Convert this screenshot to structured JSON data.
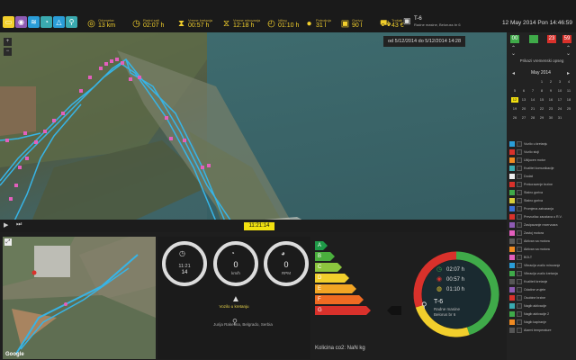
{
  "colors": {
    "accent_yellow": "#f2cf2c",
    "track_blue": "#37b4e6",
    "marker_pink": "#e35fbd",
    "green": "#3faa49",
    "red": "#d9312b",
    "orange": "#ef8a22"
  },
  "toolbar": {
    "buttons": [
      {
        "icon": "chat-icon",
        "color": "#f2cf2c",
        "glyph": "▭"
      },
      {
        "icon": "eye-icon",
        "color": "#8e5bb3",
        "glyph": "◉"
      },
      {
        "icon": "layers-icon",
        "color": "#2a9dd8",
        "glyph": "≋"
      },
      {
        "icon": "gauge-icon",
        "color": "#3aaab0",
        "glyph": "◔"
      },
      {
        "icon": "warning-icon",
        "color": "#2a9dd8",
        "glyph": "△"
      },
      {
        "icon": "pin-icon",
        "color": "#3aaab0",
        "glyph": "⚲"
      }
    ],
    "stats": [
      {
        "icon": "road-icon",
        "glyph": "◎",
        "label": "Odometar",
        "value": "13 km"
      },
      {
        "icon": "clock-icon",
        "glyph": "◷",
        "label": "Radni sati",
        "value": "02:07 h"
      },
      {
        "icon": "timer-icon",
        "glyph": "⧗",
        "label": "Vreme kretanja",
        "value": "00:57 h"
      },
      {
        "icon": "hourglass-icon",
        "glyph": "⧖",
        "label": "Vreme mirovanja",
        "value": "12:18 h"
      },
      {
        "icon": "idle-icon",
        "glyph": "◴",
        "label": "Idling",
        "value": "01:10 h"
      },
      {
        "icon": "drop-icon",
        "glyph": "●",
        "label": "Potrošnja",
        "value": "31 l"
      },
      {
        "icon": "fuel-icon",
        "glyph": "▣",
        "label": "Gorivo",
        "value": "90 l"
      },
      {
        "icon": "cart-icon",
        "glyph": "⛟",
        "label": "Trošak",
        "value": "43 €"
      }
    ]
  },
  "vehicle": {
    "name": "T-6",
    "detail": "Radne masine, Beloruss br 6"
  },
  "datetime": "12 May 2014 Pon 14:46:59",
  "map": {
    "date_range": "od 5/12/2014 do 5/12/2014 14:28",
    "time_badge": "11:21:14",
    "play_label": "▶",
    "step_label": "⏭",
    "zoom_in": "+",
    "zoom_out": "−"
  },
  "clock": {
    "h": "00",
    "m": "23",
    "s": "59"
  },
  "calendar": {
    "title": "Prikazi vremenski opseg",
    "month": "May 2014",
    "days": [
      "1",
      "2",
      "3",
      "4",
      "5",
      "6",
      "7",
      "8",
      "9",
      "10",
      "11",
      "12",
      "13",
      "14",
      "15",
      "16",
      "17",
      "18",
      "19",
      "20",
      "21",
      "22",
      "23",
      "24",
      "25",
      "26",
      "27",
      "28",
      "29",
      "30",
      "31"
    ],
    "selected": "12"
  },
  "legend": [
    {
      "color": "#2a9dd8",
      "label": "Vozilo u kretanju"
    },
    {
      "color": "#d9312b",
      "label": "Vozilo stoji"
    },
    {
      "color": "#ef8a22",
      "label": "Ukljucen motor"
    },
    {
      "color": "#3aaab0",
      "label": "Kvalitet komunikacije"
    },
    {
      "color": "#eeeeee",
      "label": "Dodati"
    },
    {
      "color": "#d9312b",
      "label": "Prekoracenje brzine"
    },
    {
      "color": "#3faa49",
      "label": "Stalno goriva"
    },
    {
      "color": "#d8ce3a",
      "label": "Stalno goriva"
    },
    {
      "color": "#3a6fd8",
      "label": "Promjena zatvaranja"
    },
    {
      "color": "#d9312b",
      "label": "Prevozilac zaustava u R.V."
    },
    {
      "color": "#8e5bb3",
      "label": "Zasipavanje rezervoara"
    },
    {
      "color": "#e35fbd",
      "label": "Zastoj motora"
    },
    {
      "color": "#5b5b5b",
      "label": "Aktivan sa motora"
    },
    {
      "color": "#ef8a22",
      "label": "Aktivan sa motora"
    },
    {
      "color": "#e35fbd",
      "label": "BOLT"
    },
    {
      "color": "#2a9dd8",
      "label": "Vibracija vozilo mirovanja"
    },
    {
      "color": "#3faa49",
      "label": "Vibracija vozilo kretanja"
    },
    {
      "color": "#555555",
      "label": "Kvaliteti kretanje"
    },
    {
      "color": "#8e5bb3",
      "label": "Odatine vrujete"
    },
    {
      "color": "#d9312b",
      "label": "Osobine brzine"
    },
    {
      "color": "#3aaab0",
      "label": "Nagib aktivacije"
    },
    {
      "color": "#3faa49",
      "label": "Nagib aktivacije 2"
    },
    {
      "color": "#ef8a22",
      "label": "Nagib kapiranje"
    },
    {
      "color": "#555555",
      "label": "Alarmi temperature"
    }
  ],
  "gauges": [
    {
      "label": "11:21",
      "value": "14",
      "unit": ""
    },
    {
      "label": "0",
      "value": "0",
      "unit": "km/h"
    },
    {
      "label": "0",
      "value": "0",
      "unit": "RPM"
    }
  ],
  "status": {
    "work": "Vozilo u kretanju",
    "address": "Jurija Raketina, Belgrado, Serbia"
  },
  "energy": {
    "grades": [
      {
        "label": "A",
        "color": "#1f9a48"
      },
      {
        "label": "B",
        "color": "#4aaf3d"
      },
      {
        "label": "C",
        "color": "#8cc63e"
      },
      {
        "label": "D",
        "color": "#f2cf2c"
      },
      {
        "label": "E",
        "color": "#f2a524"
      },
      {
        "label": "F",
        "color": "#ef6b22"
      },
      {
        "label": "G",
        "color": "#d9312b"
      }
    ],
    "selected": "G",
    "co2": "Kolicina co2: NaN kg"
  },
  "donut": {
    "work_time": "02:07 h",
    "move_time": "00:57 h",
    "idle_time": "01:10 h",
    "vehicle_name": "T-6",
    "vehicle_type": "Radne masine",
    "vehicle_owner": "Belorus br 6",
    "segments": [
      {
        "name": "green",
        "fraction": 0.45,
        "color": "#3faa49"
      },
      {
        "name": "yellow",
        "fraction": 0.25,
        "color": "#f2cf2c"
      },
      {
        "name": "red",
        "fraction": 0.3,
        "color": "#d9312b"
      }
    ]
  },
  "google": "Google"
}
